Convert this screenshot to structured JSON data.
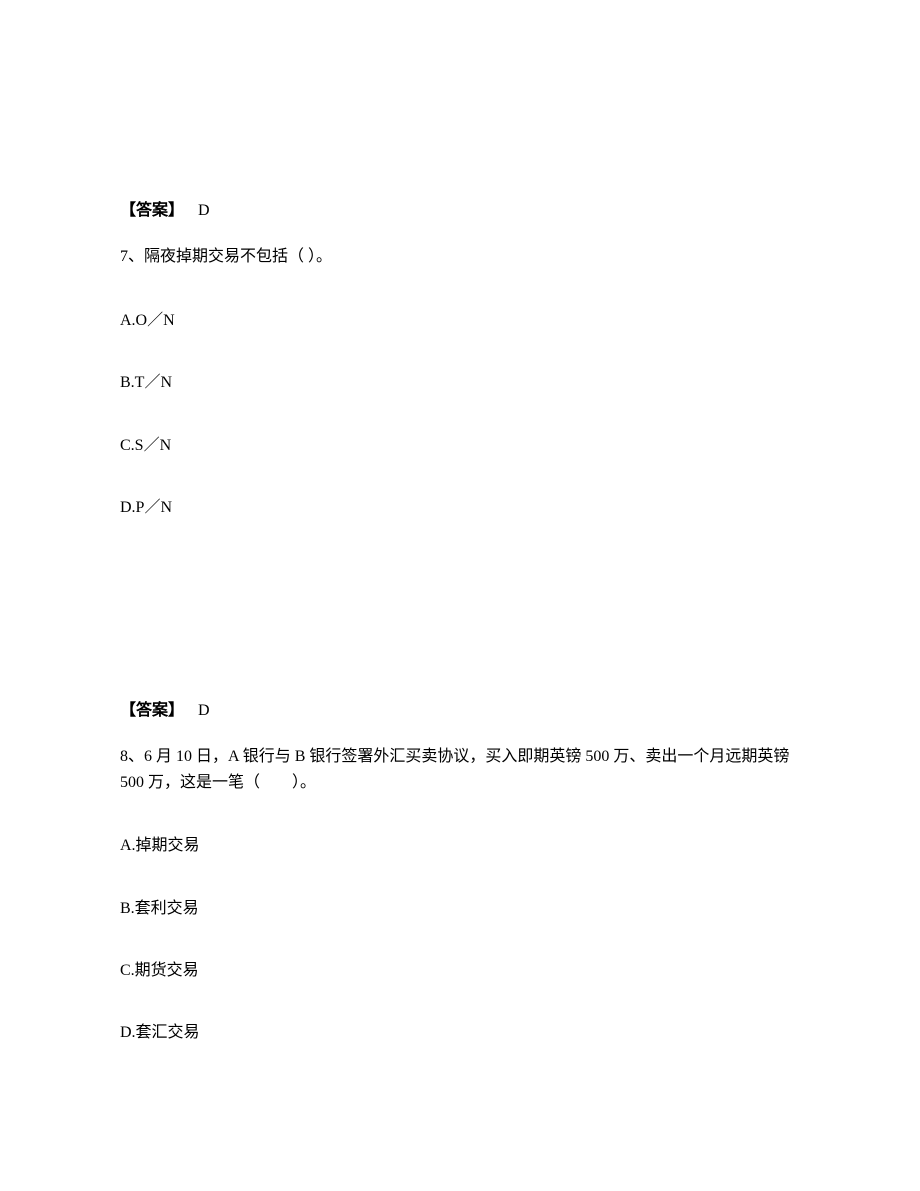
{
  "block1": {
    "answer_label": "【答案】",
    "answer_value": "D",
    "question_number": "7、",
    "question_text": "隔夜掉期交易不包括（  ）。",
    "options": {
      "a": "A.O／N",
      "b": "B.T／N",
      "c": "C.S／N",
      "d": "D.P／N"
    }
  },
  "block2": {
    "answer_label": "【答案】",
    "answer_value": "D",
    "question_number": "8、",
    "question_text": "6 月 10 日，A 银行与 B 银行签署外汇买卖协议，买入即期英镑 500 万、卖出一个月远期英镑 500 万，这是一笔（　　）。",
    "options": {
      "a": "A.掉期交易",
      "b": "B.套利交易",
      "c": "C.期货交易",
      "d": "D.套汇交易"
    }
  }
}
